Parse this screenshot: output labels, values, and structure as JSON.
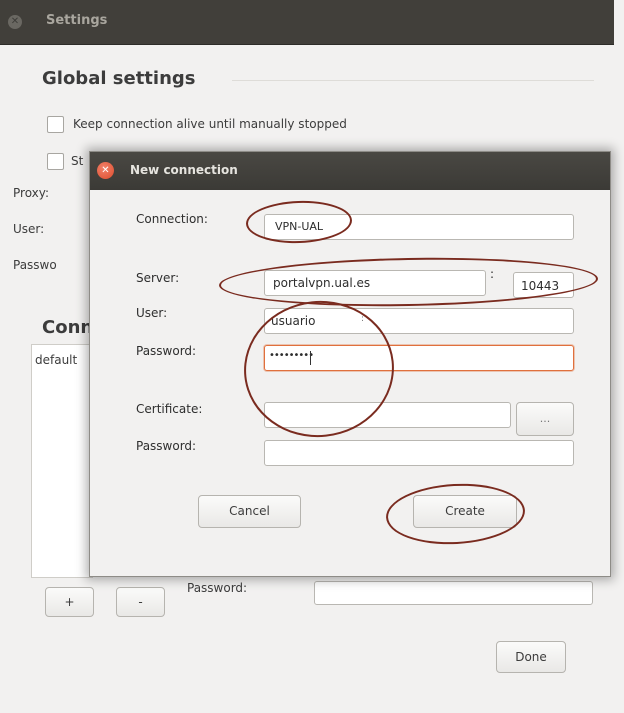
{
  "settings": {
    "title": "Settings",
    "global_heading": "Global settings",
    "keep_alive_label": "Keep connection alive until manually stopped",
    "start_label_partial": "St",
    "proxy_label": "Proxy:",
    "user_label": "User:",
    "password_label_partial": "Passwo",
    "connections_heading_partial": "Conn",
    "default_item_partial": "default",
    "add_button": "+",
    "remove_button": "-",
    "bottom_password_label": "Password:",
    "done_button": "Done"
  },
  "dialog": {
    "title": "New connection",
    "connection_label": "Connection:",
    "connection_value": "VPN-UAL",
    "server_label": "Server:",
    "server_value": "portalvpn.ual.es",
    "port_separator": ":",
    "port_value": "10443",
    "user_label": "User:",
    "user_value": "usuario",
    "user_cursor_mark": ":",
    "password_label": "Password:",
    "password_value": "•••••••••",
    "certificate_label": "Certificate:",
    "browse_button": "...",
    "cert_password_label": "Password:",
    "cancel_button": "Cancel",
    "create_button": "Create"
  }
}
